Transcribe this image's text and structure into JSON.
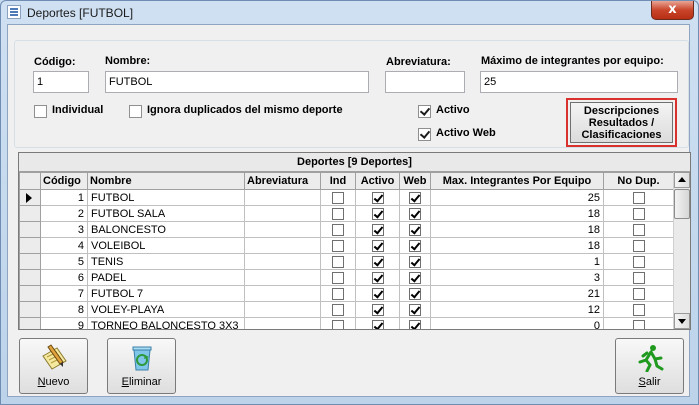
{
  "window": {
    "title": "Deportes [FUTBOL]",
    "close_glyph": "x"
  },
  "form": {
    "codigo_label": "Código:",
    "codigo_value": "1",
    "nombre_label": "Nombre:",
    "nombre_value": "FUTBOL",
    "abreviatura_label": "Abreviatura:",
    "abreviatura_value": "",
    "max_label": "Máximo de integrantes por equipo:",
    "max_value": "25",
    "individual_label": "Individual",
    "individual_checked": false,
    "ignora_label": "Ignora duplicados del mismo deporte",
    "ignora_checked": false,
    "activo_label": "Activo",
    "activo_checked": true,
    "activo_web_label": "Activo Web",
    "activo_web_checked": true,
    "desc_button_label": "Descripciones\nResultados /\nClasificaciones"
  },
  "grid": {
    "caption": "Deportes [9 Deportes]",
    "columns": [
      "Código",
      "Nombre",
      "Abreviatura",
      "Ind",
      "Activo",
      "Web",
      "Max. Integrantes Por Equipo",
      "No Dup."
    ],
    "rows": [
      {
        "codigo": "1",
        "nombre": "FUTBOL",
        "abreviatura": "",
        "ind": false,
        "activo": true,
        "web": true,
        "max": "25",
        "nodup": false
      },
      {
        "codigo": "2",
        "nombre": "FUTBOL SALA",
        "abreviatura": "",
        "ind": false,
        "activo": true,
        "web": true,
        "max": "18",
        "nodup": false
      },
      {
        "codigo": "3",
        "nombre": "BALONCESTO",
        "abreviatura": "",
        "ind": false,
        "activo": true,
        "web": true,
        "max": "18",
        "nodup": false
      },
      {
        "codigo": "4",
        "nombre": "VOLEIBOL",
        "abreviatura": "",
        "ind": false,
        "activo": true,
        "web": true,
        "max": "18",
        "nodup": false
      },
      {
        "codigo": "5",
        "nombre": "TENIS",
        "abreviatura": "",
        "ind": false,
        "activo": true,
        "web": true,
        "max": "1",
        "nodup": false
      },
      {
        "codigo": "6",
        "nombre": "PADEL",
        "abreviatura": "",
        "ind": false,
        "activo": true,
        "web": true,
        "max": "3",
        "nodup": false
      },
      {
        "codigo": "7",
        "nombre": "FUTBOL 7",
        "abreviatura": "",
        "ind": false,
        "activo": true,
        "web": true,
        "max": "21",
        "nodup": false
      },
      {
        "codigo": "8",
        "nombre": "VOLEY-PLAYA",
        "abreviatura": "",
        "ind": false,
        "activo": true,
        "web": true,
        "max": "12",
        "nodup": false
      },
      {
        "codigo": "9",
        "nombre": "TORNEO  BALONCESTO 3X3",
        "abreviatura": "",
        "ind": false,
        "activo": true,
        "web": true,
        "max": "0",
        "nodup": false
      }
    ]
  },
  "toolbar": {
    "nuevo_label": "Nuevo",
    "eliminar_label": "Eliminar",
    "salir_label": "Salir",
    "nuevo_icon": "notepad-pencil-icon",
    "eliminar_icon": "recycle-bin-icon",
    "salir_icon": "running-man-icon"
  },
  "colors": {
    "highlight_border": "#d9322e",
    "close_button": "#c9452a",
    "exit_icon": "#1f9a1f"
  }
}
